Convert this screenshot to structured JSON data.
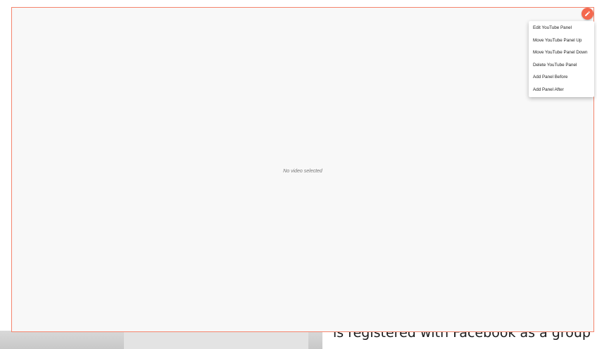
{
  "panel": {
    "placeholder_text": "No video selected",
    "edit_button_icon": "pencil-icon",
    "border_color": "#f4846c",
    "accent_color": "#f4684e"
  },
  "menu": {
    "items": [
      {
        "label": "Edit YouTube Panel"
      },
      {
        "label": "Move YouTube Panel Up"
      },
      {
        "label": "Move YouTube Panel Down"
      },
      {
        "label": "Delete YouTube Panel"
      },
      {
        "label": "Add Panel Before"
      },
      {
        "label": "Add Panel After"
      }
    ]
  },
  "background": {
    "partial_text": "is registered with Facebook as a group"
  }
}
